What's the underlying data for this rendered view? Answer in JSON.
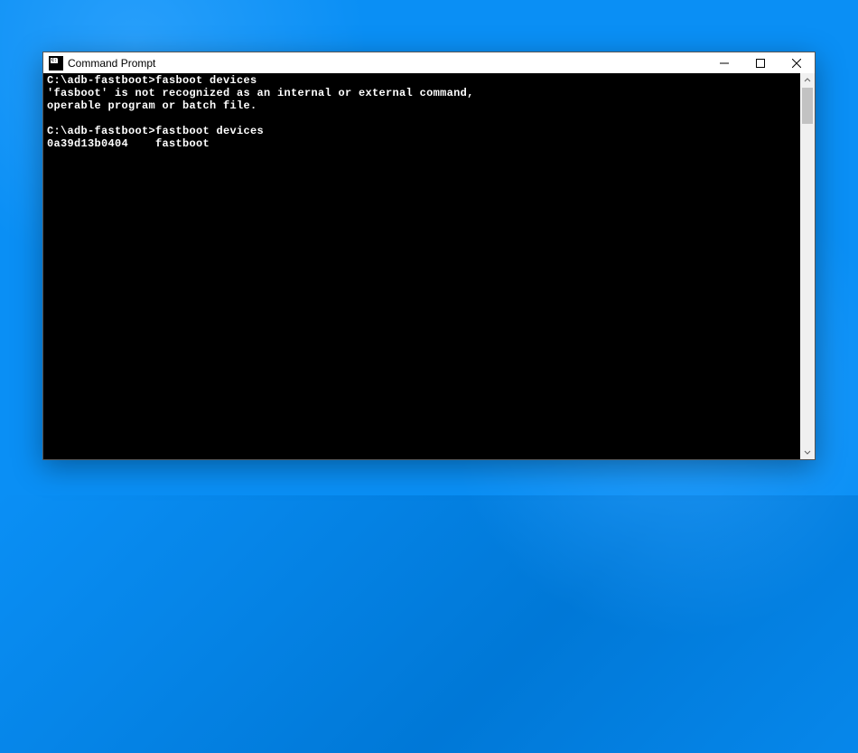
{
  "window": {
    "title": "Command Prompt"
  },
  "terminal": {
    "lines": [
      "C:\\adb-fastboot>fasboot devices",
      "'fasboot' is not recognized as an internal or external command,",
      "operable program or batch file.",
      "",
      "C:\\adb-fastboot>fastboot devices",
      "0a39d13b0404    fastboot"
    ]
  }
}
